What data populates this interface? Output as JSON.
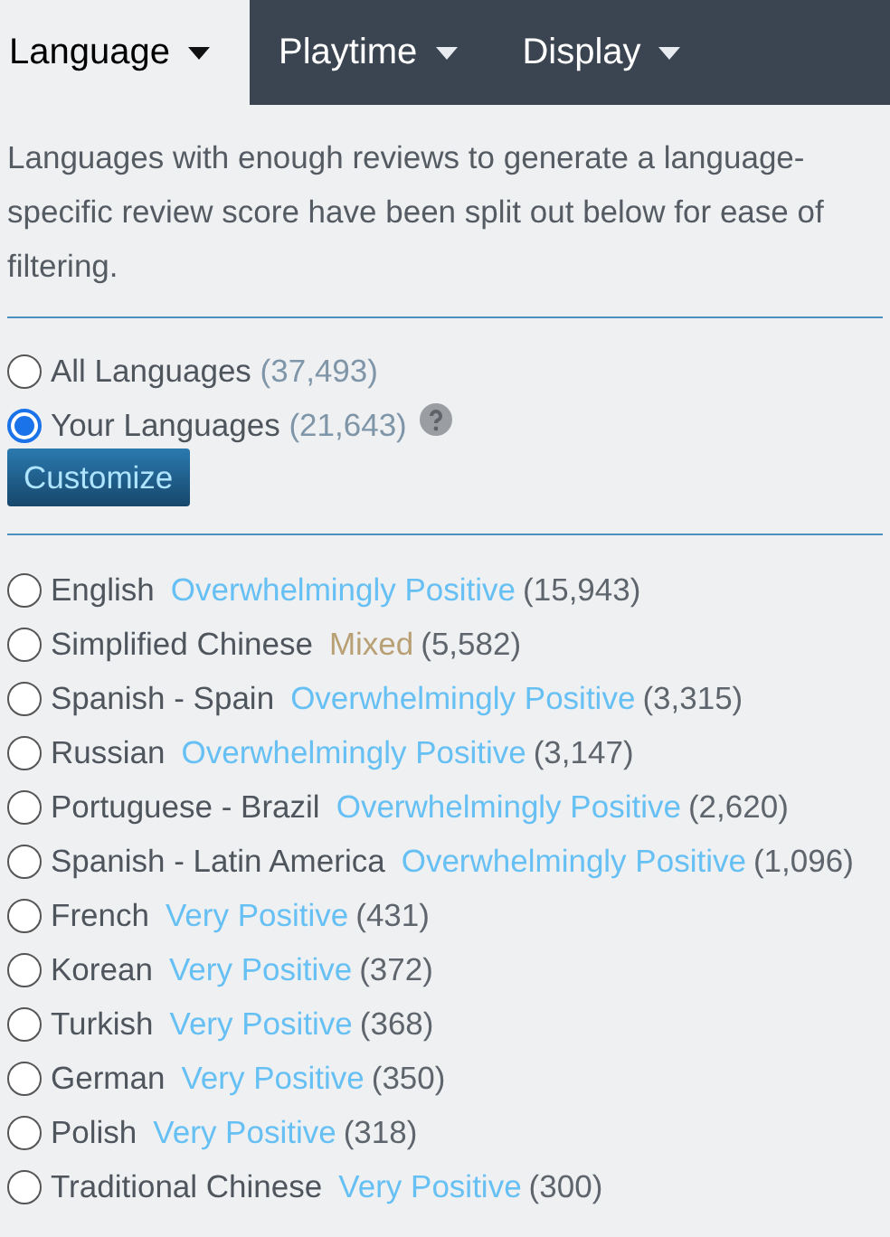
{
  "tabs": [
    {
      "label": "Language",
      "selected": true
    },
    {
      "label": "Playtime",
      "selected": false
    },
    {
      "label": "Display",
      "selected": false
    }
  ],
  "description": "Languages with enough reviews to generate a language-specific review score have been split out below for ease of filtering.",
  "scope_options": [
    {
      "label": "All Languages",
      "count": "(37,493)",
      "selected": false,
      "help": false
    },
    {
      "label": "Your Languages",
      "count": "(21,643)",
      "selected": true,
      "help": true
    }
  ],
  "customize_button": "Customize",
  "languages": [
    {
      "name": "English",
      "score": "Overwhelmingly Positive",
      "kind": "positive",
      "count": "(15,943)",
      "selected": false
    },
    {
      "name": "Simplified Chinese",
      "score": "Mixed",
      "kind": "mixed",
      "count": "(5,582)",
      "selected": false
    },
    {
      "name": "Spanish - Spain",
      "score": "Overwhelmingly Positive",
      "kind": "positive",
      "count": "(3,315)",
      "selected": false
    },
    {
      "name": "Russian",
      "score": "Overwhelmingly Positive",
      "kind": "positive",
      "count": "(3,147)",
      "selected": false
    },
    {
      "name": "Portuguese - Brazil",
      "score": "Overwhelmingly Positive",
      "kind": "positive",
      "count": "(2,620)",
      "selected": false
    },
    {
      "name": "Spanish - Latin America",
      "score": "Overwhelmingly Positive",
      "kind": "positive",
      "count": "(1,096)",
      "selected": false
    },
    {
      "name": "French",
      "score": "Very Positive",
      "kind": "positive",
      "count": "(431)",
      "selected": false
    },
    {
      "name": "Korean",
      "score": "Very Positive",
      "kind": "positive",
      "count": "(372)",
      "selected": false
    },
    {
      "name": "Turkish",
      "score": "Very Positive",
      "kind": "positive",
      "count": "(368)",
      "selected": false
    },
    {
      "name": "German",
      "score": "Very Positive",
      "kind": "positive",
      "count": "(350)",
      "selected": false
    },
    {
      "name": "Polish",
      "score": "Very Positive",
      "kind": "positive",
      "count": "(318)",
      "selected": false
    },
    {
      "name": "Traditional Chinese",
      "score": "Very Positive",
      "kind": "positive",
      "count": "(300)",
      "selected": false
    }
  ]
}
